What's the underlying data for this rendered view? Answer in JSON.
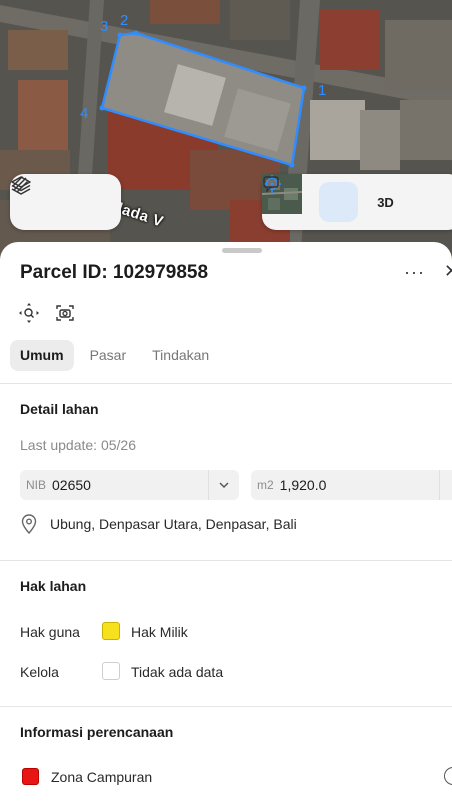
{
  "map": {
    "street_label": "dada V",
    "vertices": [
      "1",
      "2",
      "3",
      "4"
    ],
    "colors": {
      "parcel_outline": "#2f8dff",
      "street_label": "#ffffff"
    },
    "left_controls": [
      {
        "name": "layers-icon"
      },
      {
        "name": "measure-icon"
      }
    ],
    "right_controls": [
      {
        "name": "satellite-thumbnail"
      },
      {
        "name": "locate-icon"
      },
      {
        "name": "3d-toggle",
        "label": "3D"
      },
      {
        "name": "feedback-icon"
      }
    ]
  },
  "sheet": {
    "title": "Parcel ID: 102979858",
    "more_label": "···",
    "close_label": "✕",
    "tool_icons": [
      "zoom-to-parcel-icon",
      "screenshot-icon"
    ],
    "tabs": [
      {
        "label": "Umum",
        "active": true
      },
      {
        "label": "Pasar",
        "active": false
      },
      {
        "label": "Tindakan",
        "active": false
      }
    ],
    "detail": {
      "title": "Detail lahan",
      "last_update": "Last update: 05/26",
      "nib_prefix": "NIB",
      "nib_value": "02650",
      "area_prefix": "m2",
      "area_value": "1,920.0",
      "location": "Ubung, Denpasar Utara, Denpasar, Bali"
    },
    "hak": {
      "title": "Hak lahan",
      "rows": [
        {
          "label": "Hak guna",
          "value": "Hak Milik",
          "color": "#f7e01d"
        },
        {
          "label": "Kelola",
          "value": "Tidak ada data",
          "color": "#ffffff"
        }
      ]
    },
    "planning": {
      "title": "Informasi perencanaan",
      "zone": "Zona Campuran",
      "zone_color": "#e81515"
    }
  }
}
